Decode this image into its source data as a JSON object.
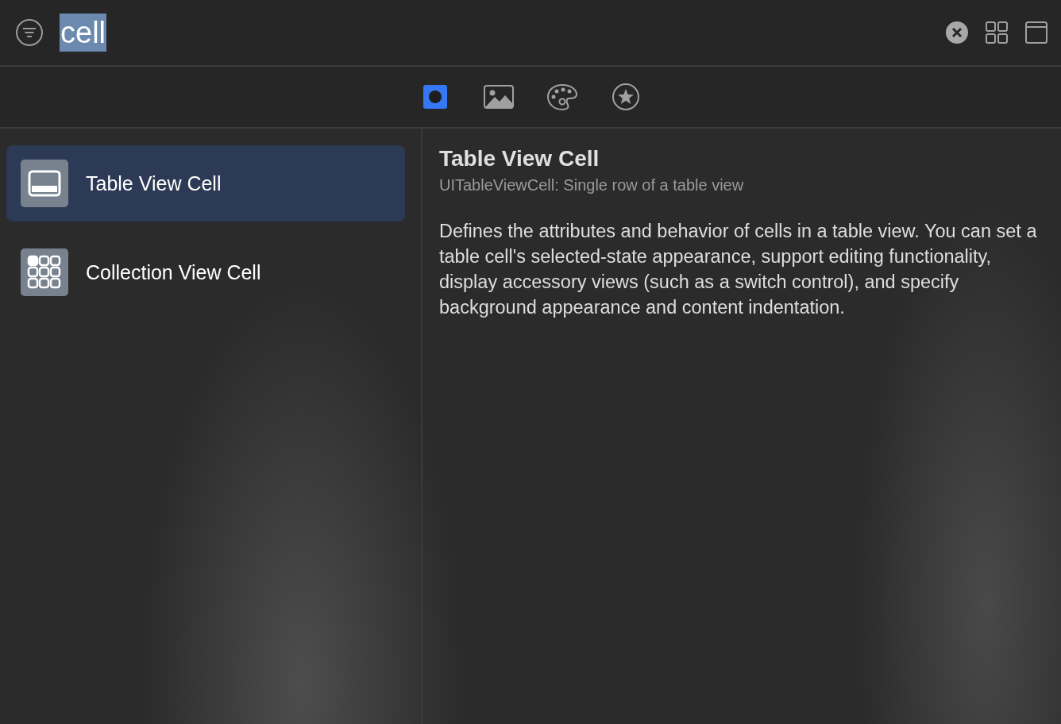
{
  "search": {
    "value": "cell",
    "text_selected": true
  },
  "tabs": [
    {
      "kind": "objects",
      "selected": true
    },
    {
      "kind": "images",
      "selected": false
    },
    {
      "kind": "colors",
      "selected": false
    },
    {
      "kind": "favorites",
      "selected": false
    }
  ],
  "items": [
    {
      "kind": "table",
      "label": "Table View Cell",
      "selected": true
    },
    {
      "kind": "collection",
      "label": "Collection View Cell",
      "selected": false
    }
  ],
  "detail": {
    "title": "Table View Cell",
    "subtitle": "UITableViewCell: Single row of a table view",
    "description": "Defines the attributes and behavior of cells in a table view. You can set a table cell's selected-state appearance, support editing functionality, display accessory views (such as a switch control), and specify background appearance and content indentation."
  }
}
